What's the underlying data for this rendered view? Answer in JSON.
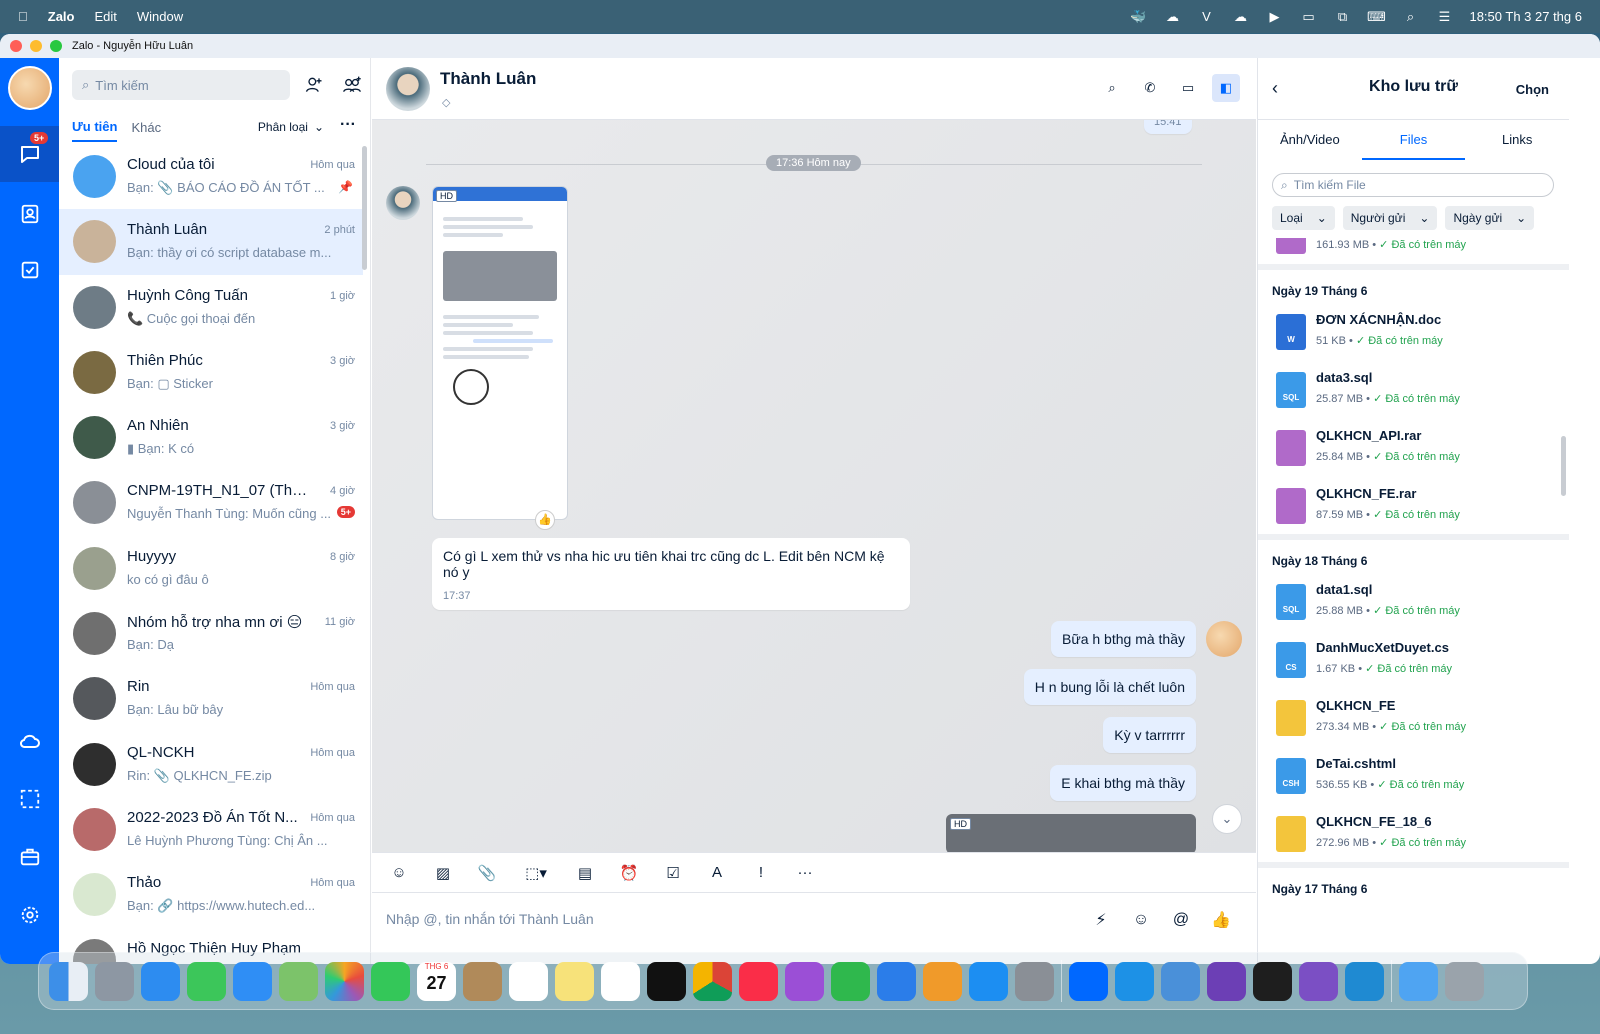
{
  "menubar": {
    "app": "Zalo",
    "edit": "Edit",
    "window": "Window",
    "clock": "18:50 Th 3 27 thg 6"
  },
  "window_title": "Zalo - Nguyễn Hữu Luân",
  "rail": {
    "badge": "5+"
  },
  "conversations": {
    "search_placeholder": "Tìm kiếm",
    "tab_priority": "Ưu tiên",
    "tab_other": "Khác",
    "sort_label": "Phân loại",
    "items": [
      {
        "name": "Cloud của tôi",
        "time": "Hôm qua",
        "preview": "Bạn: 📎 BÁO CÁO ĐỒ ÁN TỐT ...",
        "color": "#4aa3f0"
      },
      {
        "name": "Thành Luân",
        "time": "2 phút",
        "preview": "Bạn: thầy ơi có script database m...",
        "color": "#c9b39a"
      },
      {
        "name": "Huỳnh Công Tuấn",
        "time": "1 giờ",
        "preview": "📞 Cuộc gọi thoại đến",
        "color": "#6e7c86"
      },
      {
        "name": "Thiên Phúc",
        "time": "3 giờ",
        "preview": "Bạn: ▢ Sticker",
        "color": "#7a6a42"
      },
      {
        "name": "An Nhiên",
        "time": "3 giờ",
        "preview": "▮ Bạn: K có",
        "color": "#3f5a4a"
      },
      {
        "name": "CNPM-19TH_N1_07 (ThS. ...",
        "time": "4 giờ",
        "preview": "Nguyễn Thanh Tùng: Muốn cũng ...",
        "color": "#8a8f96",
        "badge": "5+"
      },
      {
        "name": "Huyyyy",
        "time": "8 giờ",
        "preview": "ko có gì đâu ô",
        "color": "#9aa08e"
      },
      {
        "name": "Nhóm hỗ trợ nha mn ơi 😑",
        "time": "11 giờ",
        "preview": "Bạn: Dạ",
        "color": "#6f6f6f"
      },
      {
        "name": "Rin",
        "time": "Hôm qua",
        "preview": "Bạn: Lâu bữ bây",
        "color": "#55585c"
      },
      {
        "name": "QL-NCKH",
        "time": "Hôm qua",
        "preview": "Rin: 📎 QLKHCN_FE.zip",
        "color": "#2e2e2e"
      },
      {
        "name": "2022-2023 Đồ Án Tốt N...",
        "time": "Hôm qua",
        "preview": "Lê Huỳnh Phương Tùng: Chị Ân ...",
        "color": "#b86a6a"
      },
      {
        "name": "Thảo",
        "time": "Hôm qua",
        "preview": "Bạn: 🔗 https://www.hutech.ed...",
        "color": "#d9e8d0"
      },
      {
        "name": "Hồ Ngọc Thiện Huy Phạm",
        "time": "",
        "preview": "",
        "color": "#7a7a7a"
      }
    ]
  },
  "chat": {
    "name": "Thành Luân",
    "time_top": "15:41",
    "divider": "17:36 Hôm nay",
    "hd": "HD",
    "msg_in": "Có gì L xem thử vs nha hic ưu tiên khai trc cũng dc L. Edit bên NCM kệ nó y",
    "msg_in_time": "17:37",
    "msgs_out": [
      "Bữa h bthg mà thầy",
      "H n bung lỗi là chết luôn",
      "Kỳ v tarrrrrr",
      "E khai bthg mà thầy"
    ],
    "placeholder": "Nhập @, tin nhắn tới Thành Luân"
  },
  "storage": {
    "title": "Kho lưu trữ",
    "choose": "Chọn",
    "tabs": [
      "Ảnh/Video",
      "Files",
      "Links"
    ],
    "search_placeholder": "Tìm kiếm File",
    "filters": [
      "Loại",
      "Người gửi",
      "Ngày gửi"
    ],
    "on_device": "Đã có trên máy",
    "top_file_size": "161.93 MB",
    "sections": [
      {
        "date": "Ngày 19 Tháng 6",
        "files": [
          {
            "name": "ĐƠN XÁCNHẬN.doc",
            "size": "51 KB",
            "type": "W",
            "color": "#2b6fd6"
          },
          {
            "name": "data3.sql",
            "size": "25.87 MB",
            "type": "SQL",
            "color": "#3b9ae8"
          },
          {
            "name": "QLKHCN_API.rar",
            "size": "25.84 MB",
            "type": "",
            "color": "#b06ac9"
          },
          {
            "name": "QLKHCN_FE.rar",
            "size": "87.59 MB",
            "type": "",
            "color": "#b06ac9"
          }
        ]
      },
      {
        "date": "Ngày 18 Tháng 6",
        "files": [
          {
            "name": "data1.sql",
            "size": "25.88 MB",
            "type": "SQL",
            "color": "#3b9ae8"
          },
          {
            "name": "DanhMucXetDuyet.cs",
            "size": "1.67 KB",
            "type": "CS",
            "color": "#3b9ae8"
          },
          {
            "name": "QLKHCN_FE",
            "size": "273.34 MB",
            "type": "",
            "color": "#f3c53c"
          },
          {
            "name": "DeTai.cshtml",
            "size": "536.55 KB",
            "type": "CSH",
            "color": "#3b9ae8"
          },
          {
            "name": "QLKHCN_FE_18_6",
            "size": "272.96 MB",
            "type": "",
            "color": "#f3c53c"
          }
        ]
      },
      {
        "date": "Ngày 17 Tháng 6",
        "files": []
      }
    ]
  },
  "dock": {
    "calendar_month": "THG 6",
    "calendar_day": "27"
  }
}
